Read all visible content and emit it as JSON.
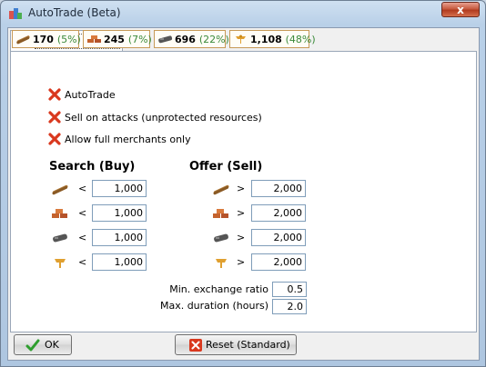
{
  "window": {
    "title": "AutoTrade (Beta)",
    "close_label": "x"
  },
  "tab": {
    "label": "["
  },
  "resources": [
    {
      "icon": "wood-icon",
      "amount": "170",
      "percent": "(5%)"
    },
    {
      "icon": "clay-icon",
      "amount": "245",
      "percent": "(7%)"
    },
    {
      "icon": "iron-icon",
      "amount": "696",
      "percent": "(22%)"
    },
    {
      "icon": "crop-icon",
      "amount": "1,108",
      "percent": "(48%)"
    }
  ],
  "options": [
    {
      "label": "AutoTrade"
    },
    {
      "label": "Sell on attacks (unprotected resources)"
    },
    {
      "label": "Allow full merchants only"
    }
  ],
  "search": {
    "title": "Search (Buy)",
    "operator": "<",
    "values": [
      "1,000",
      "1,000",
      "1,000",
      "1,000"
    ]
  },
  "offer": {
    "title": "Offer (Sell)",
    "operator": ">",
    "values": [
      "2,000",
      "2,000",
      "2,000",
      "2,000"
    ]
  },
  "params": {
    "min_ratio_label": "Min. exchange ratio",
    "min_ratio_value": "0.5",
    "max_duration_label": "Max. duration (hours)",
    "max_duration_value": "2.0"
  },
  "buttons": {
    "ok_label": "OK",
    "reset_label": "Reset (Standard)"
  }
}
